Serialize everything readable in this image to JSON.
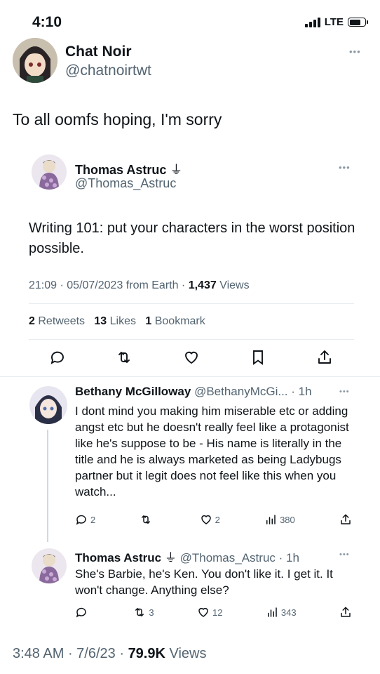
{
  "status_bar": {
    "time": "4:10",
    "network": "LTE"
  },
  "main_tweet": {
    "author": {
      "name": "Chat Noir",
      "handle": "@chatnoirtwt"
    },
    "text": "To all oomfs hoping, I'm sorry"
  },
  "quoted_tweet": {
    "author": {
      "name": "Thomas Astruc",
      "verified_glyph": "⏚",
      "handle": "@Thomas_Astruc"
    },
    "text": "Writing 101: put your characters in the worst position possible.",
    "time": "21:09",
    "date": "05/07/2023",
    "source": "from Earth",
    "views": "1,437",
    "views_label": "Views",
    "retweets": "2",
    "retweets_label": "Retweets",
    "likes": "13",
    "likes_label": "Likes",
    "bookmarks": "1",
    "bookmarks_label": "Bookmark"
  },
  "replies": [
    {
      "name": "Bethany McGilloway",
      "handle": "@BethanyMcGi...",
      "age": "1h",
      "text": "I dont mind you making him miserable etc or adding angst etc but he doesn't really feel like a protagonist like he's suppose to be - His name is literally in the title and he is always marketed as being Ladybugs partner but it legit does not feel like this when you watch...",
      "replies": "2",
      "retweets": "",
      "likes": "2",
      "views": "380"
    },
    {
      "name": "Thomas Astruc",
      "verified_glyph": "⏚",
      "handle": "@Thomas_Astruc",
      "age": "1h",
      "text": "She's Barbie, he's Ken. You don't like it. I get it. It won't change. Anything else?",
      "replies": "",
      "retweets": "3",
      "likes": "12",
      "views": "343"
    }
  ],
  "footer": {
    "time": "3:48 AM",
    "date": "7/6/23",
    "views": "79.9K",
    "views_label": "Views"
  },
  "colors": {
    "text": "#0f1419",
    "secondary": "#536471",
    "divider": "#e6ecf0"
  }
}
